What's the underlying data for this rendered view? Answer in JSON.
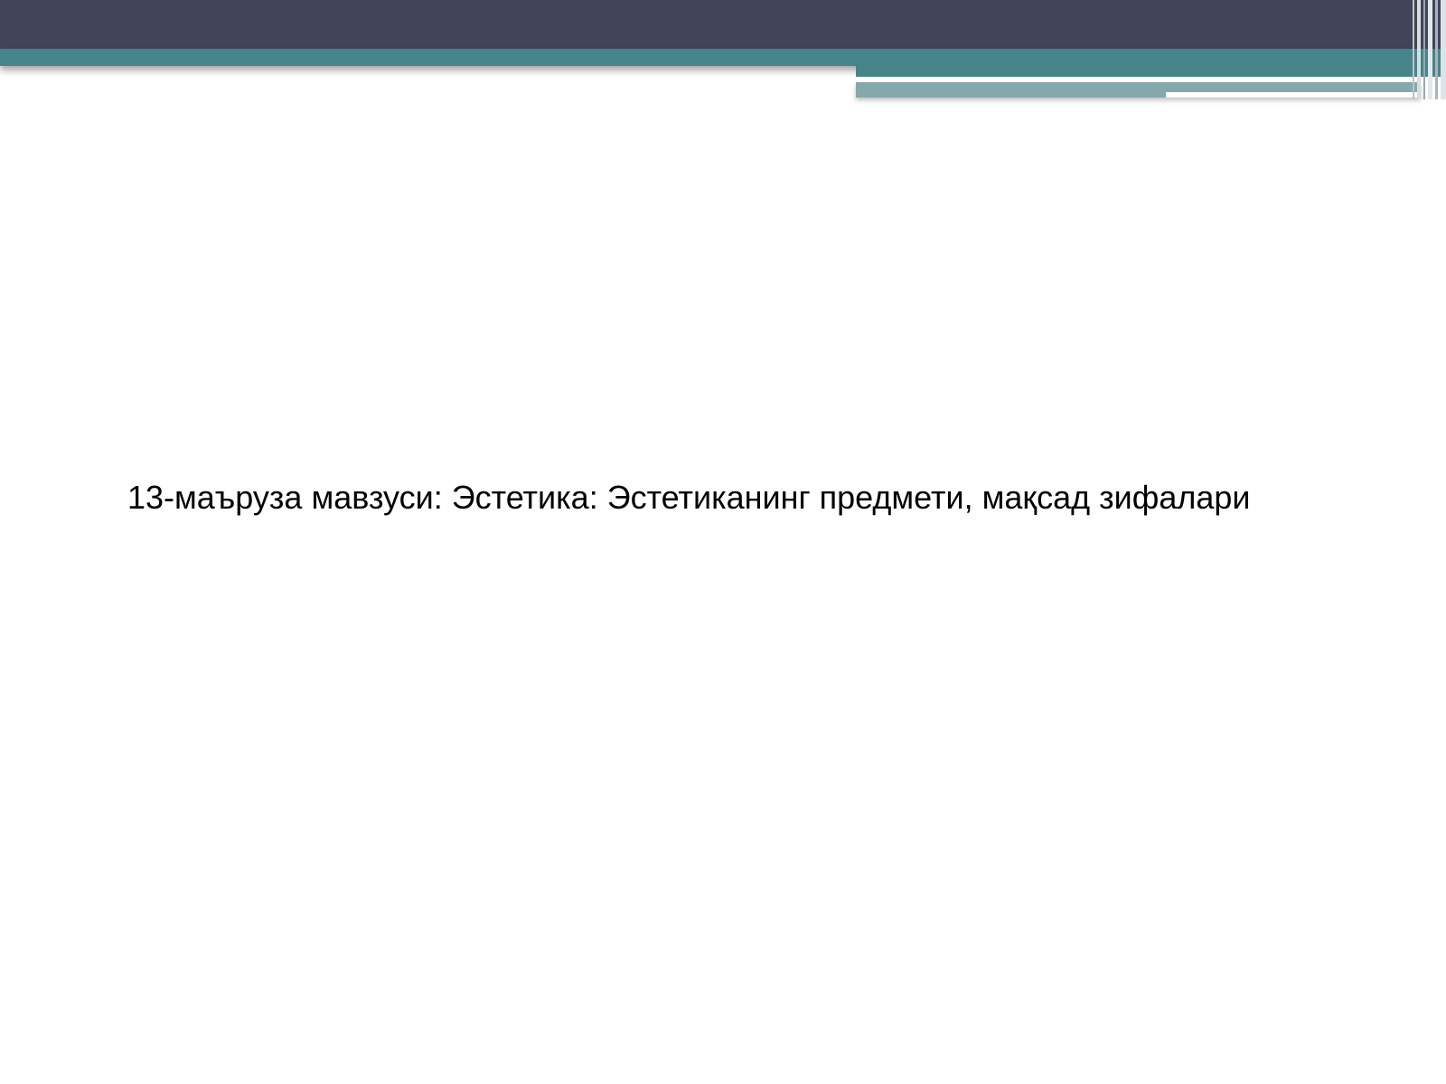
{
  "slide": {
    "title": "13-маъруза мавзуси: Эстетика: Эстетиканинг предмети, мақсад зифалари"
  },
  "theme": {
    "header_dark": "#424459",
    "header_teal": "#47848a",
    "stripe_gray": "#85a8ac",
    "background": "#ffffff",
    "text": "#000000"
  }
}
